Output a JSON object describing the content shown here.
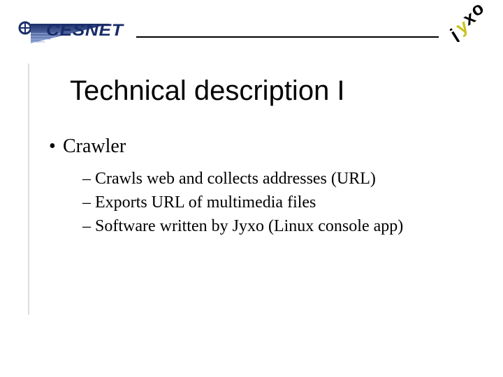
{
  "header": {
    "cesnet_label": "CESNET",
    "jyxo_label": "jyxo"
  },
  "title": "Technical description I",
  "content": {
    "item1": {
      "label": "Crawler",
      "sub1": "Crawls web and collects addresses (URL)",
      "sub2": "Exports URL of multimedia files",
      "sub3": "Software written by Jyxo (Linux console app)"
    }
  }
}
